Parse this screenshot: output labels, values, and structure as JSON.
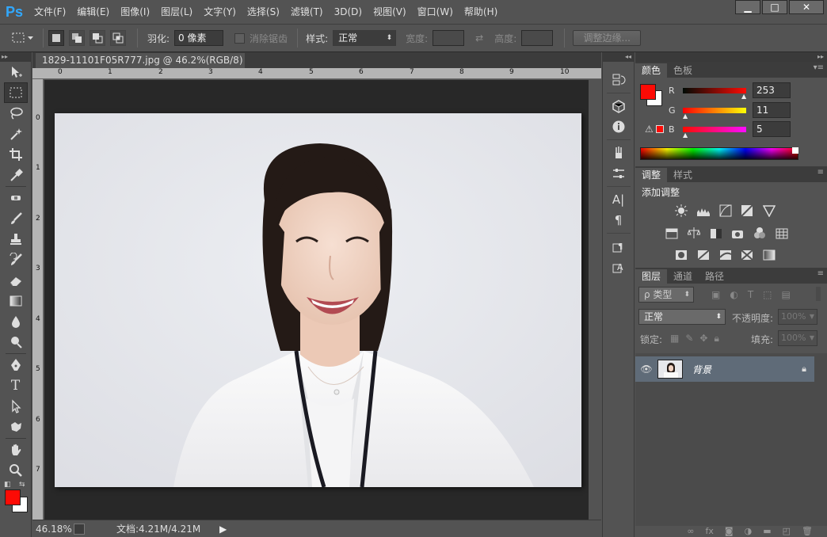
{
  "app": {
    "logo": "Ps"
  },
  "menu": [
    "文件(F)",
    "编辑(E)",
    "图像(I)",
    "图层(L)",
    "文字(Y)",
    "选择(S)",
    "滤镜(T)",
    "3D(D)",
    "视图(V)",
    "窗口(W)",
    "帮助(H)"
  ],
  "window_controls": {
    "minimize": "▁",
    "restore": "□",
    "close": "✕"
  },
  "options": {
    "feather_label": "羽化:",
    "feather_value": "0 像素",
    "antialias_label": "消除锯齿",
    "style_label": "样式:",
    "style_value": "正常",
    "width_label": "宽度:",
    "height_label": "高度:",
    "refine_edge": "调整边缘..."
  },
  "document": {
    "tab_title": "1829-11101F05R777.jpg @ 46.2%(RGB/8)",
    "tab_close": "×",
    "ruler_top": [
      "0",
      "1",
      "2",
      "3",
      "4",
      "5",
      "6",
      "7",
      "8",
      "9",
      "10"
    ],
    "ruler_left": [
      "0",
      "1",
      "2",
      "3",
      "4",
      "5",
      "6",
      "7"
    ]
  },
  "status": {
    "zoom": "46.18%",
    "doc": "文档:4.21M/4.21M",
    "arrow": "▶"
  },
  "color_panel": {
    "tabs": [
      "颜色",
      "色板"
    ],
    "foreground": "#fd0b05",
    "background": "#ffffff",
    "channels": [
      {
        "name": "R",
        "value": "253"
      },
      {
        "name": "G",
        "value": "11"
      },
      {
        "name": "B",
        "value": "5"
      }
    ]
  },
  "adjust_panel": {
    "tabs": [
      "调整",
      "样式"
    ],
    "title": "添加调整"
  },
  "layers_panel": {
    "tabs": [
      "图层",
      "通道",
      "路径"
    ],
    "filter_label": "ρ 类型",
    "blend_mode": "正常",
    "opacity_label": "不透明度:",
    "opacity_value": "100%",
    "lock_label": "锁定:",
    "fill_label": "填充:",
    "fill_value": "100%",
    "layer_name": "背景"
  }
}
